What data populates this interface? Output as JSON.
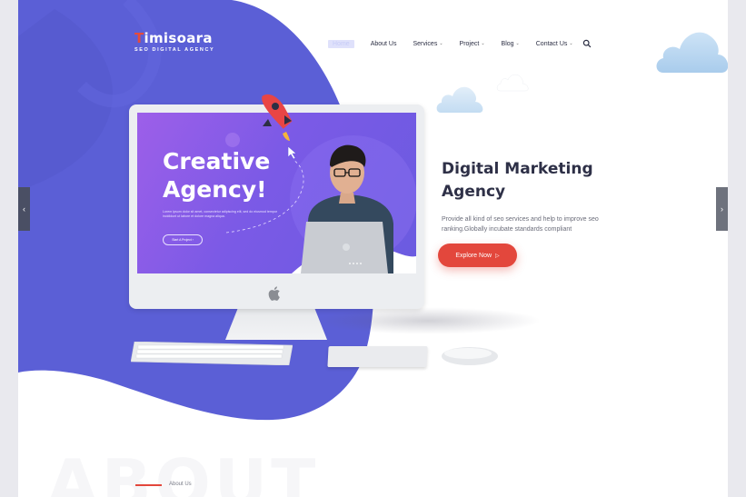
{
  "brand": {
    "name": "Timisoara",
    "tagline": "SEO DIGITAL AGENCY"
  },
  "nav": {
    "items": [
      {
        "label": "Home"
      },
      {
        "label": "About Us"
      },
      {
        "label": "Services",
        "caret": true
      },
      {
        "label": "Project",
        "caret": true
      },
      {
        "label": "Blog",
        "caret": true
      },
      {
        "label": "Contact Us",
        "caret": true
      }
    ],
    "search_icon": "search-icon"
  },
  "hero": {
    "title_line1": "Digital Marketing",
    "title_line2": "Agency",
    "description": "Provide all kind of seo services and help to improve seo ranking.Globally incubate standards compliant",
    "button_label": "Explore Now"
  },
  "screen": {
    "title_line1": "Creative",
    "title_line2": "Agency!",
    "text": "Lorem ipsum dolor sit amet, consectetur adipiscing elit, sed do eiusmod tempor incididunt ut labore et dolore magna aliqua.",
    "button_label": "Start A Project"
  },
  "slider": {
    "prev_icon": "chevron-left-icon",
    "next_icon": "chevron-right-icon",
    "prev": "‹",
    "next": "›"
  },
  "about": {
    "watermark": "ABOUT",
    "label": "About Us"
  },
  "colors": {
    "primary": "#5b5fd6",
    "accent": "#e3473c",
    "heading": "#2e3047"
  }
}
